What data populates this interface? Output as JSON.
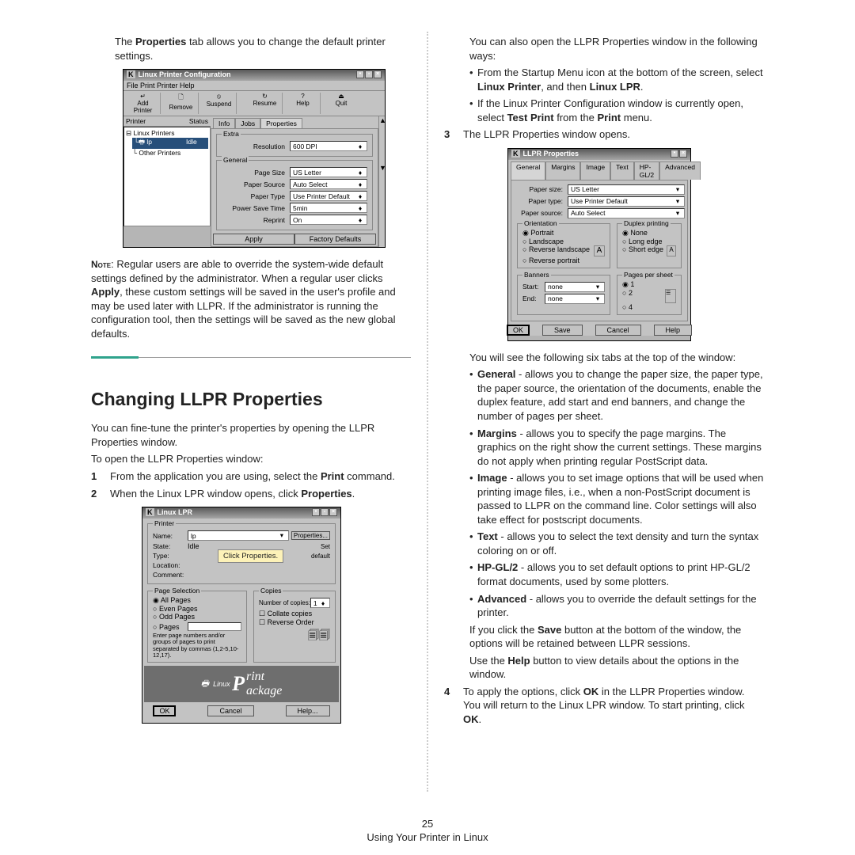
{
  "left": {
    "intro1a": "The ",
    "intro1b": "Properties",
    "intro1c": " tab allows you to change the default printer settings.",
    "note_label": "Note",
    "note_text": ": Regular users are able to override the system-wide default settings defined by the administrator. When a regular user clicks ",
    "note_apply": "Apply",
    "note_text2": ", these custom settings will be saved in the user's profile and may be used later with LLPR. If the administrator is running the configuration tool, then the settings will be saved as the new global defaults.",
    "heading": "Changing LLPR Properties",
    "p1": "You can fine-tune the printer's properties by opening the LLPR Properties window.",
    "p2": "To open the LLPR Properties window:",
    "step1": "From the application you are using, select the ",
    "step1b": "Print",
    "step1c": " command.",
    "step2a": "When the Linux LPR window opens, click ",
    "step2b": "Properties",
    "step2c": ".",
    "callout": "Click Properties."
  },
  "shot1": {
    "title": "Linux Printer Configuration",
    "menu": "File   Print   Printer   Help",
    "tb": [
      "Add Printer",
      "Remove",
      "Suspend",
      "Resume",
      "Help",
      "Quit"
    ],
    "hdr_l": "Printer",
    "hdr_r": "Status",
    "tree_root": "Linux Printers",
    "sel_name": "lp",
    "sel_state": "Idle",
    "tree_2": "Other Printers",
    "tabs": [
      "Info",
      "Jobs",
      "Properties"
    ],
    "grp_extra": "Extra",
    "res_l": "Resolution",
    "res_v": "600 DPI",
    "grp_general": "General",
    "rows": [
      {
        "l": "Page Size",
        "v": "US Letter"
      },
      {
        "l": "Paper Source",
        "v": "Auto Select"
      },
      {
        "l": "Paper Type",
        "v": "Use Printer Default"
      },
      {
        "l": "Power Save Time",
        "v": "5min"
      },
      {
        "l": "Reprint",
        "v": "On"
      }
    ],
    "apply": "Apply",
    "factory": "Factory Defaults"
  },
  "shot2": {
    "title": "Linux LPR",
    "grp_printer": "Printer",
    "props_btn": "Properties...",
    "name_l": "Name:",
    "name_v": "lp",
    "state_l": "State:",
    "state_v": "Idle",
    "type_l": "Type:",
    "loc_l": "Location:",
    "com_l": "Comment:",
    "set_l": "Set",
    "def_l": "default",
    "grp_ps": "Page Selection",
    "all": "All Pages",
    "even": "Even Pages",
    "odd": "Odd Pages",
    "pgs": "Pages",
    "hint": "Enter page numbers and/or groups of pages to print separated by commas (1,2-5,10-12,17).",
    "grp_copies": "Copies",
    "nc": "Number of copies:",
    "nc_v": "1",
    "collate": "Collate copies",
    "reverse": "Reverse Order",
    "logo1": "Linux",
    "logoP": "P",
    "logo2": "rint",
    "logo3": "ackage",
    "ok": "OK",
    "cancel": "Cancel",
    "help": "Help..."
  },
  "right": {
    "r1": "You can also open the LLPR Properties window in the following ways:",
    "b1a": "From the Startup Menu icon at the bottom of the screen, select ",
    "b1b": "Linux Printer",
    "b1c": ", and then ",
    "b1d": "Linux LPR",
    "b1e": ".",
    "b2a": "If the Linux Printer Configuration window is currently open, select ",
    "b2b": "Test Print",
    "b2c": " from the ",
    "b2d": "Print",
    "b2e": " menu.",
    "s3": "The LLPR Properties window opens.",
    "r2a": "You will see the following six tabs at the top of the window:",
    "t_general": "General",
    "d_general": " - allows you to change the paper size, the paper type, the paper source, the orientation of the documents, enable the duplex feature, add start and end banners, and change the number of pages per sheet.",
    "t_margins": "Margins",
    "d_margins": " - allows you to specify the page margins. The graphics on the right show the current settings. These margins do not apply when printing regular PostScript data.",
    "t_image": "Image",
    "d_image": " - allows you to set image options that will be used when printing image files, i.e., when a non-PostScript document is passed to LLPR on the command line. Color settings will also take effect for postscript documents.",
    "t_text": "Text",
    "d_text": " - allows you to select the text density and turn the syntax coloring on or off.",
    "t_hpgl": "HP-GL/2",
    "d_hpgl": " - allows you to set default options to print HP-GL/2 format documents, used by some plotters.",
    "t_adv": "Advanced",
    "d_adv": " - allows you to override the default settings for the printer.",
    "r3a": "If you click the ",
    "r3b": "Save",
    "r3c": " button at the bottom of the window, the options will be retained between LLPR sessions.",
    "r4a": "Use the ",
    "r4b": "Help",
    "r4c": " button to view details about the options in the window.",
    "s4a": "To apply the options, click ",
    "s4b": "OK",
    "s4c": " in the LLPR Properties window. You will return to the Linux LPR window. To start printing, click ",
    "s4d": "OK",
    "s4e": "."
  },
  "shot3": {
    "title": "LLPR Properties",
    "tabs": [
      "General",
      "Margins",
      "Image",
      "Text",
      "HP-GL/2",
      "Advanced"
    ],
    "rows": [
      {
        "l": "Paper size:",
        "v": "US Letter"
      },
      {
        "l": "Paper type:",
        "v": "Use Printer Default"
      },
      {
        "l": "Paper source:",
        "v": "Auto Select"
      }
    ],
    "grp_o": "Orientation",
    "o": [
      "Portrait",
      "Landscape",
      "Reverse landscape",
      "Reverse portrait"
    ],
    "grp_d": "Duplex printing",
    "d": [
      "None",
      "Long edge",
      "Short edge"
    ],
    "grp_b": "Banners",
    "grp_pps": "Pages per sheet",
    "start": "Start:",
    "end": "End:",
    "none": "none",
    "pps": [
      "1",
      "2",
      "4"
    ],
    "ok": "OK",
    "save": "Save",
    "cancel": "Cancel",
    "help": "Help"
  },
  "footer": {
    "pg": "25",
    "txt": "Using Your Printer in Linux"
  }
}
